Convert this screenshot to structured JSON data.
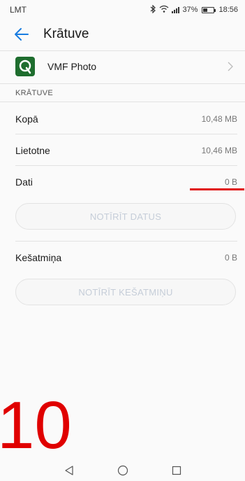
{
  "status_bar": {
    "carrier": "LMT",
    "battery": "37%",
    "time": "18:56"
  },
  "header": {
    "title": "Krātuve"
  },
  "app": {
    "name": "VMF Photo",
    "icon_letter": "Q"
  },
  "storage": {
    "section_title": "KRĀTUVE",
    "rows": [
      {
        "label": "Kopā",
        "value": "10,48 MB"
      },
      {
        "label": "Lietotne",
        "value": "10,46 MB"
      },
      {
        "label": "Dati",
        "value": "0 B"
      }
    ],
    "clear_data_label": "NOTĪRĪT DATUS",
    "cache_label": "Kešatmiņa",
    "cache_value": "0 B",
    "clear_cache_label": "NOTĪRĪT KEŠATMIŅU"
  },
  "annotation": {
    "step_number": "10",
    "color": "#e00000"
  },
  "colors": {
    "accent": "#1a7de0",
    "app_icon_bg": "#1e6d2e",
    "disabled_text": "#c5cdd8"
  }
}
